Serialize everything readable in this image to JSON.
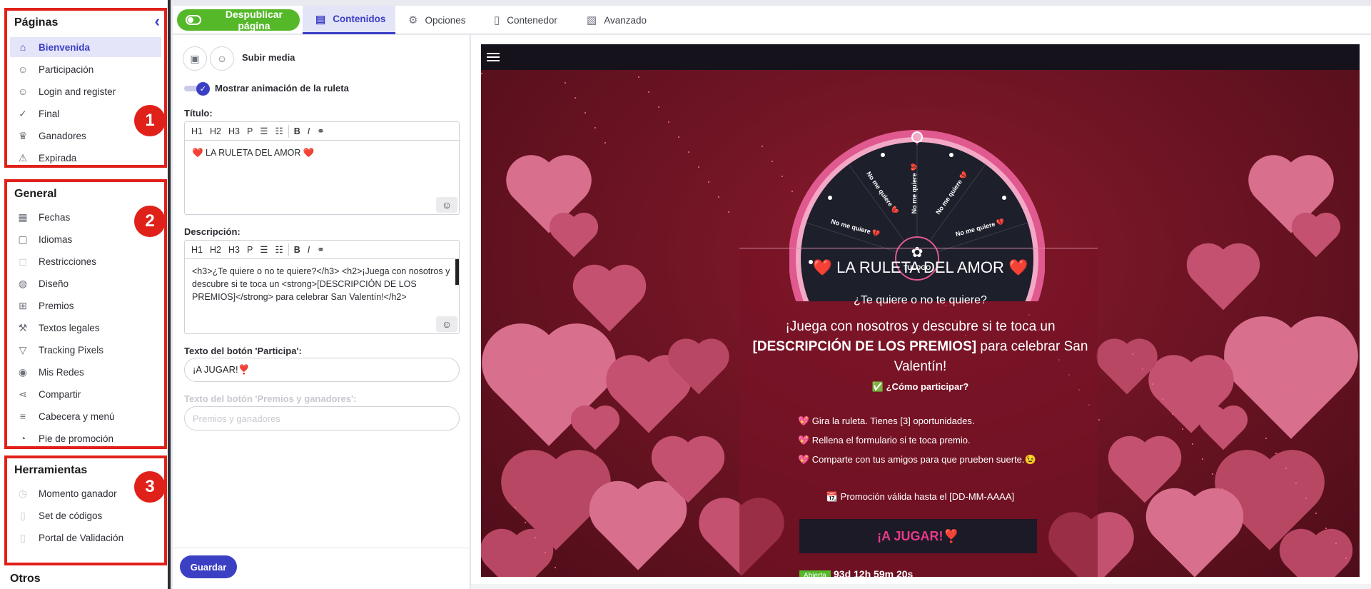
{
  "sidebar": {
    "collapse_icon": "chevron-left-icon",
    "sections": [
      {
        "title": "Páginas",
        "badge": "1",
        "items": [
          {
            "label": "Bienvenida",
            "icon": "home-icon"
          },
          {
            "label": "Participación",
            "icon": "user-icon"
          },
          {
            "label": "Login and register",
            "icon": "user-lock-icon"
          },
          {
            "label": "Final",
            "icon": "check-icon"
          },
          {
            "label": "Ganadores",
            "icon": "trophy-icon"
          },
          {
            "label": "Expirada",
            "icon": "warning-icon"
          }
        ]
      },
      {
        "title": "General",
        "badge": "2",
        "items": [
          {
            "label": "Fechas",
            "icon": "calendar-icon"
          },
          {
            "label": "Idiomas",
            "icon": "chat-icon"
          },
          {
            "label": "Restricciones",
            "icon": "lock-icon"
          },
          {
            "label": "Diseño",
            "icon": "palette-icon"
          },
          {
            "label": "Premios",
            "icon": "gift-icon"
          },
          {
            "label": "Textos legales",
            "icon": "gavel-icon"
          },
          {
            "label": "Tracking Pixels",
            "icon": "filter-icon"
          },
          {
            "label": "Mis Redes",
            "icon": "globe-icon"
          },
          {
            "label": "Compartir",
            "icon": "share-icon"
          },
          {
            "label": "Cabecera y menú",
            "icon": "menu-icon"
          },
          {
            "label": "Pie de promoción",
            "icon": "pie-chart-icon"
          }
        ]
      },
      {
        "title": "Herramientas",
        "badge": "3",
        "items": [
          {
            "label": "Momento ganador",
            "icon": "clock-icon"
          },
          {
            "label": "Set de códigos",
            "icon": "code-icon"
          },
          {
            "label": "Portal de Validación",
            "icon": "checklist-icon"
          }
        ]
      },
      {
        "title": "Otros"
      }
    ]
  },
  "topbar": {
    "publish_label": "Despublicar página",
    "tabs": [
      {
        "label": "Contenidos",
        "icon": "clipboard-icon"
      },
      {
        "label": "Opciones",
        "icon": "gear-icon"
      },
      {
        "label": "Contenedor",
        "icon": "file-icon"
      },
      {
        "label": "Avanzado",
        "icon": "advanced-icon"
      }
    ]
  },
  "editor": {
    "upload_label": "Subir media",
    "show_wheel_label": "Mostrar animación de la ruleta",
    "title_label": "Título:",
    "title_value": "❤️ LA RULETA DEL AMOR ❤️",
    "toolbar": [
      "H1",
      "H2",
      "H3",
      "P",
      "B",
      "I"
    ],
    "description_label": "Descripción:",
    "description_value": "<h3>¿Te quiere o no te quiere?</h3> <h2>¡Juega con nosotros y descubre si te toca un <strong>[DESCRIPCIÓN DE LOS PREMIOS]</strong> para celebrar San Valentín!</h2>",
    "participate_label": "Texto del botón 'Participa':",
    "participate_value": "¡A JUGAR!❣️",
    "prizes_label": "Texto del botón 'Premios y ganadores':",
    "prizes_placeholder": "Premios y ganadores",
    "save_label": "Guardar"
  },
  "preview": {
    "wheel_segments": [
      "No me quiere 💔",
      "No me quiere 💔",
      "No me quiere 💔",
      "No me quiere 💔",
      "No me quiere 💔"
    ],
    "logo_text": "TULOGO",
    "title": "❤️ LA RULETA DEL AMOR ❤️",
    "subtitle": "¿Te quiere o no te quiere?",
    "desc_part1": "¡Juega con nosotros y descubre si te toca un ",
    "desc_strong": "[DESCRIPCIÓN DE LOS PREMIOS]",
    "desc_part2": " para celebrar San Valentín!",
    "how_title": "✅ ¿Cómo participar?",
    "steps": [
      "💖 Gira la ruleta. Tienes [3] oportunidades.",
      "💖 Rellena el formulario si te toca premio.",
      "💖 Comparte con tus amigos para que prueben suerte.😉"
    ],
    "valid_until": "📆 Promoción válida hasta el [DD-MM-AAAA]",
    "play_label": "¡A JUGAR!❣️",
    "open_badge": "Abierta",
    "countdown": "93d 12h 59m 20s"
  }
}
